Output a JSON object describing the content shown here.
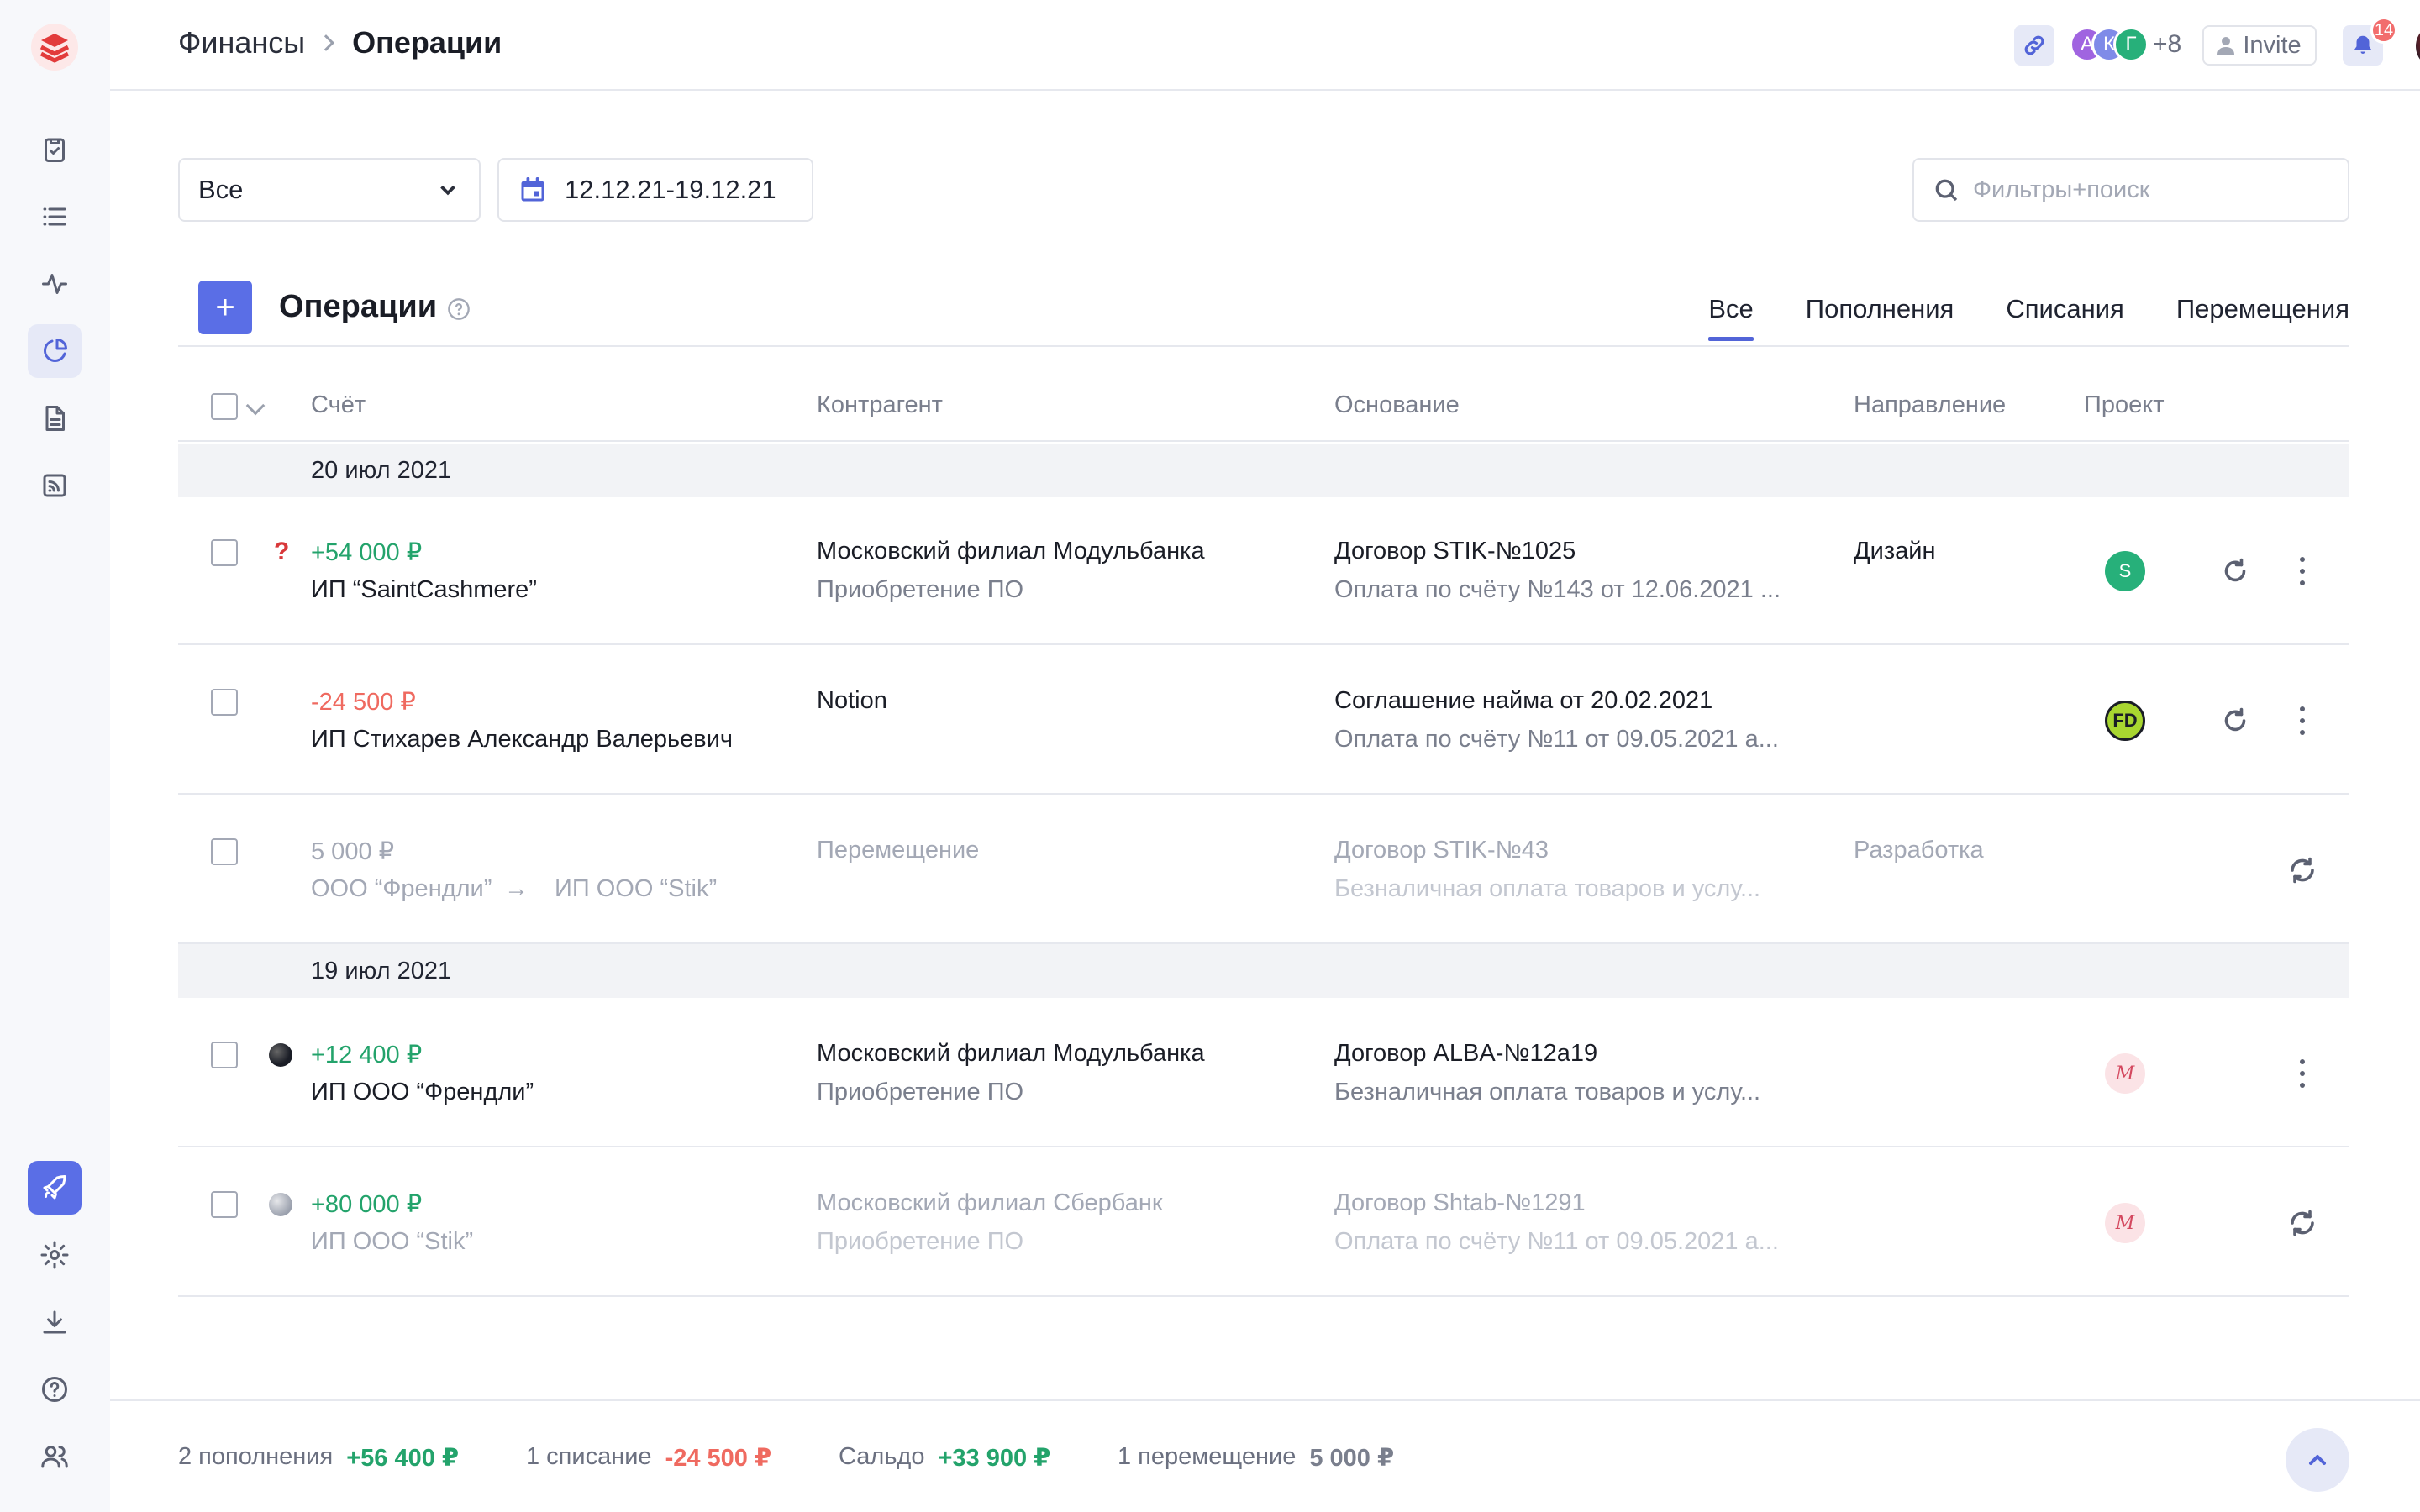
{
  "breadcrumbs": {
    "parent": "Финансы",
    "current": "Операции"
  },
  "header": {
    "avatars": [
      {
        "letter": "А",
        "color": "#a064e0"
      },
      {
        "letter": "К",
        "color": "#7f8be8"
      },
      {
        "letter": "Г",
        "color": "#27b07a"
      }
    ],
    "more_count": "+8",
    "invite_label": "Invite",
    "notifications": "14"
  },
  "filters": {
    "select_value": "Все",
    "date_range": "12.12.21-19.12.21",
    "search_placeholder": "Фильтры+поиск"
  },
  "section": {
    "add_label": "+",
    "title": "Операции",
    "tabs": [
      "Все",
      "Пополнения",
      "Списания",
      "Перемещения"
    ],
    "active_tab": "Все"
  },
  "table": {
    "columns": [
      "Счёт",
      "Контрагент",
      "Основание",
      "Направление",
      "Проект"
    ],
    "groups": [
      {
        "date": "20 июл 2021",
        "rows": [
          {
            "amount": "+54 000 ₽",
            "account": "ИП “SaintCashmere”",
            "counterparty": "Московский филиал  Модульбанка",
            "counterparty_sub": "Приобретение ПО",
            "basis": "Договор STIK-№1025",
            "basis_sub": "Оплата по счёту №143 от 12.06.2021 ...",
            "direction": "Дизайн",
            "project": "S"
          },
          {
            "amount": "-24 500 ₽",
            "account": "ИП Стихарев Александр Валерьевич",
            "counterparty": "Notion",
            "counterparty_sub": "",
            "basis": "Соглашение найма от 20.02.2021",
            "basis_sub": "Оплата по счёту №11 от 09.05.2021 а...",
            "direction": "",
            "project": "FD"
          },
          {
            "amount": "5 000 ₽",
            "account_from": "ООО “Френдли”",
            "account_to": "ИП ООО “Stik”",
            "counterparty": "Перемещение",
            "basis": "Договор STIK-№43",
            "basis_sub": "Безналичная оплата товаров и услу...",
            "direction": "Разработка"
          }
        ]
      },
      {
        "date": "19 июл 2021",
        "rows": [
          {
            "amount": "+12 400 ₽",
            "account": "ИП ООО “Френдли”",
            "counterparty": "Московский филиал  Модульбанка",
            "counterparty_sub": "Приобретение ПО",
            "basis": "Договор ALBA-№12a19",
            "basis_sub": "Безналичная оплата товаров и услу...",
            "direction": "",
            "project": "M"
          },
          {
            "amount": "+80 000 ₽",
            "account": "ИП ООО “Stik”",
            "counterparty": "Московский филиал Сбербанк",
            "counterparty_sub": "Приобретение ПО",
            "basis": "Договор Shtab-№1291",
            "basis_sub": "Оплата по счёту №11 от 09.05.2021 а...",
            "direction": "",
            "project": "M"
          }
        ]
      }
    ]
  },
  "footer": {
    "income_label": "2 пополнения",
    "income_value": "+56 400 ₽",
    "expense_label": "1 списание",
    "expense_value": "-24 500 ₽",
    "balance_label": "Сальдо",
    "balance_value": "+33 900 ₽",
    "transfer_label": "1 перемещение",
    "transfer_value": "5 000 ₽"
  }
}
